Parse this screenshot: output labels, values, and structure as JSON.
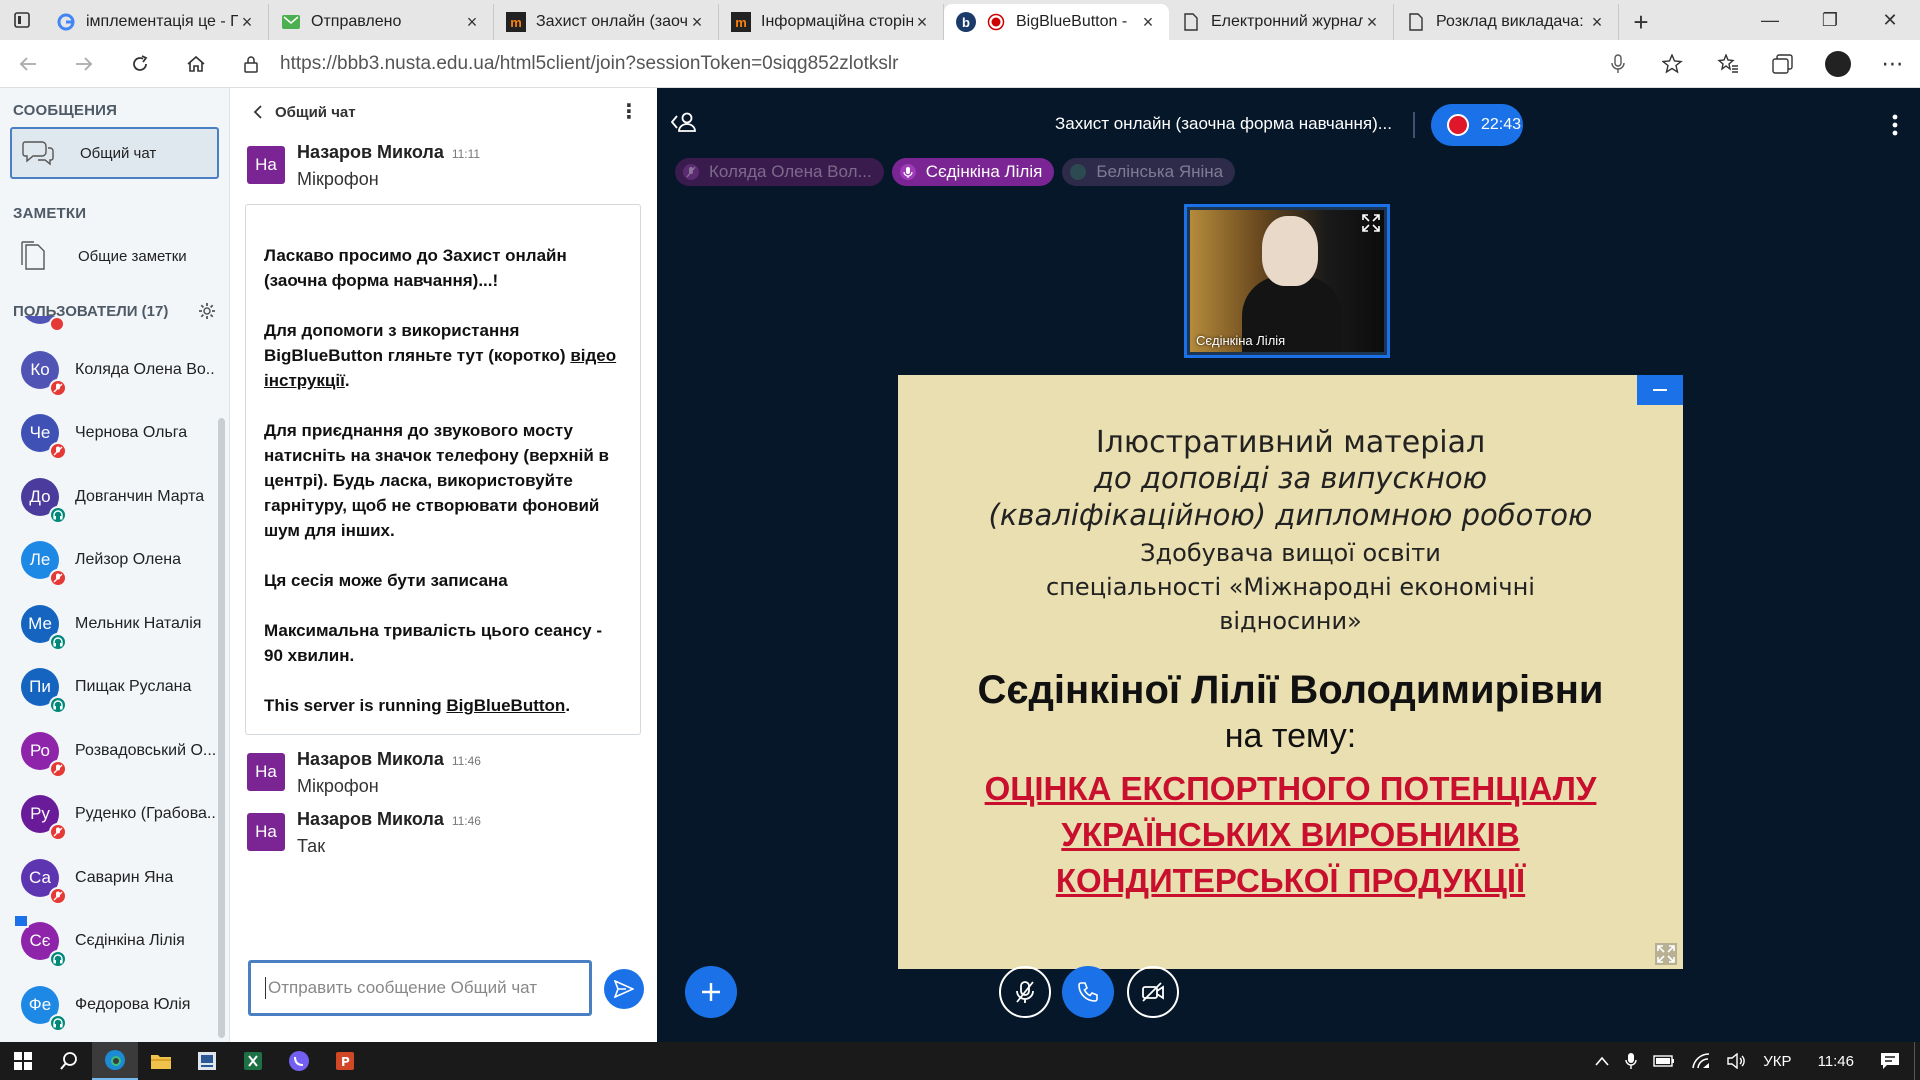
{
  "browser": {
    "tabs": [
      {
        "title": "імплементація це - П",
        "icon": "google-icon",
        "active": false
      },
      {
        "title": "Отправлено",
        "icon": "mail-icon",
        "active": false
      },
      {
        "title": "Захист онлайн (заочн",
        "icon": "moodle-icon",
        "active": false
      },
      {
        "title": "Інформаційна сторін",
        "icon": "moodle-icon",
        "active": false
      },
      {
        "title": "BigBlueButton - ",
        "icon": "bbb-icon",
        "active": true
      },
      {
        "title": "Електронний журнал",
        "icon": "page-icon",
        "active": false
      },
      {
        "title": "Розклад викладача: ",
        "icon": "page-icon",
        "active": false
      }
    ],
    "url": "https://bbb3.nusta.edu.ua/html5client/join?sessionToken=0siqg852zlotkslr"
  },
  "sidebar": {
    "messages_title": "СООБЩЕНИЯ",
    "public_chat": "Общий чат",
    "notes_title": "ЗАМЕТКИ",
    "shared_notes": "Общие заметки",
    "users_title": "ПОЛЬЗОВАТЕЛИ (17)",
    "users": [
      {
        "initials": "Ко",
        "name": "Коляда Олена Во...",
        "color": "#5054b5",
        "status": "muted"
      },
      {
        "initials": "Че",
        "name": "Чернова Ольга",
        "color": "#3f51b5",
        "status": "muted"
      },
      {
        "initials": "До",
        "name": "Довганчин Марта",
        "color": "#4a3b9c",
        "status": "listen"
      },
      {
        "initials": "Ле",
        "name": "Лейзор Олена",
        "color": "#1e88e5",
        "status": "muted"
      },
      {
        "initials": "Ме",
        "name": "Мельник Наталія",
        "color": "#1565c0",
        "status": "listen"
      },
      {
        "initials": "Пи",
        "name": "Пищак Руслана",
        "color": "#1565c0",
        "status": "listen"
      },
      {
        "initials": "Ро",
        "name": "Розвадовський О...",
        "color": "#8e24aa",
        "status": "muted"
      },
      {
        "initials": "Ру",
        "name": "Руденко (Грабова...",
        "color": "#6a1b9a",
        "status": "muted"
      },
      {
        "initials": "Са",
        "name": "Саварин Яна",
        "color": "#5e35b1",
        "status": "muted"
      },
      {
        "initials": "Сє",
        "name": "Сєдінкіна Лілія",
        "color": "#8e24aa",
        "status": "listen"
      },
      {
        "initials": "Фе",
        "name": "Федорова Юлія",
        "color": "#1e88e5",
        "status": "listen"
      }
    ]
  },
  "chat": {
    "header": "Общий чат",
    "msg1": {
      "initials": "На",
      "name": "Назаров Микола",
      "time": "11:11",
      "text": "Мікрофон"
    },
    "welcome": {
      "p1a": "Ласкаво просимо до ",
      "p1b": "Захист онлайн (заочна форма навчання)",
      "p1c": "...!",
      "p2a": "Для допомоги з використання BigBlueButton гляньте тут (коротко) ",
      "p2link": "відео інструкції",
      "p2end": ".",
      "p3a": "Для приєднання до звукового мосту натисніть на значок телефону (верхній в центрі). ",
      "p3b": "Будь ласка, використовуйте гарнітуру, щоб не створювати фоновий шум для інших.",
      "p4": "Ця сесія може бути записана",
      "p5": "Максимальна тривалість цього сеансу - 90 хвилин.",
      "p6a": "This server is running ",
      "p6link": "BigBlueButton",
      "p6end": "."
    },
    "msg2": {
      "initials": "На",
      "name": "Назаров Микола",
      "time": "11:46",
      "text": "Мікрофон"
    },
    "msg3": {
      "initials": "На",
      "name": "Назаров Микола",
      "time": "11:46",
      "text": "Так"
    },
    "input_placeholder": "Отправить сообщение Общий чат"
  },
  "stage": {
    "meeting_title": "Захист онлайн (заочна форма навчання)...",
    "recording_time": "22:43",
    "talkers": [
      {
        "name": "Коляда Олена Вол...",
        "state": "muted"
      },
      {
        "name": "Сєдінкіна Лілія",
        "state": "talking"
      },
      {
        "name": "Белінська Яніна",
        "state": "idle"
      }
    ],
    "video_name": "Сєдінкіна Лілія"
  },
  "slide": {
    "line1": "Ілюстративний матеріал",
    "line2": "до доповіді за випускною",
    "line3": "(кваліфікаційною) дипломною роботою",
    "line4": "Здобувача вищої освіти",
    "line5": "спеціальності  «Міжнародні економічні",
    "line6": "відносини»",
    "name": "Сєдінкіної Лілії Володимирівни",
    "topic_label": "на тему:",
    "topic1": "ОЦІНКА ЕКСПОРТНОГО ПОТЕНЦІАЛУ",
    "topic2": "УКРАЇНСЬКИХ ВИРОБНИКІВ",
    "topic3": "КОНДИТЕРСЬКОЇ ПРОДУКЦІЇ"
  },
  "taskbar": {
    "lang": "УКР",
    "time": "11:46"
  },
  "colors": {
    "accent": "#1b72e8",
    "stage_bg": "#06172a",
    "slide_bg": "#eadfb0",
    "topic_red": "#c8102e",
    "chat_avatar": "#7a2593"
  }
}
